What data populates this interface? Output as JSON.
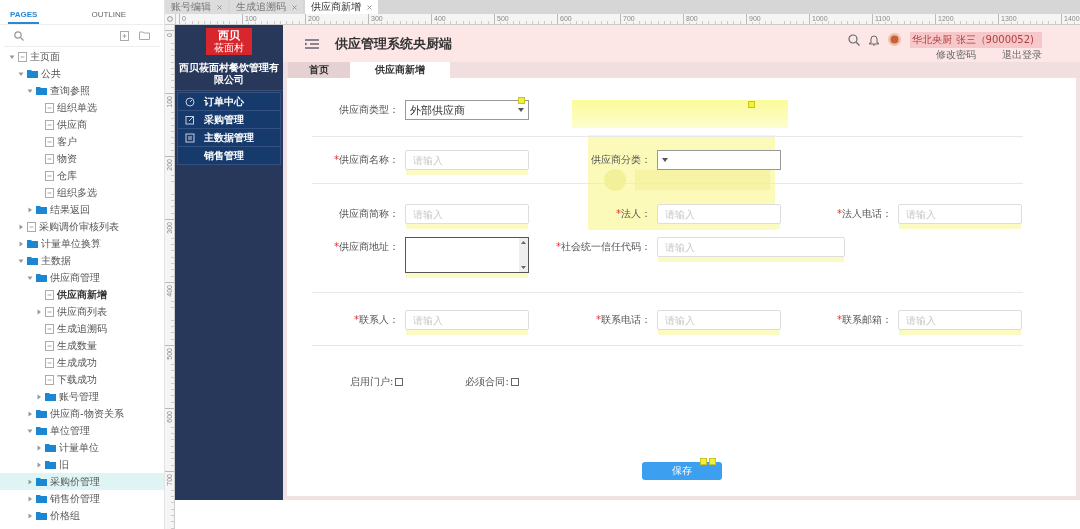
{
  "pages_panel": {
    "tabs": [
      {
        "label": "PAGES",
        "selected": true
      },
      {
        "label": "OUTLINE",
        "selected": false
      }
    ],
    "tree": [
      {
        "label": "主页面",
        "kind": "page",
        "expanded": true,
        "selected": false,
        "current": false,
        "children": [
          {
            "label": "公共",
            "kind": "folder",
            "expanded": true,
            "selected": false,
            "current": false,
            "children": [
              {
                "label": "查询参照",
                "kind": "folder",
                "expanded": true,
                "selected": false,
                "current": false,
                "children": [
                  {
                    "label": "组织单选",
                    "kind": "page",
                    "selected": false,
                    "current": false
                  },
                  {
                    "label": "供应商",
                    "kind": "page",
                    "selected": false,
                    "current": false
                  },
                  {
                    "label": "客户",
                    "kind": "page",
                    "selected": false,
                    "current": false
                  },
                  {
                    "label": "物资",
                    "kind": "page",
                    "selected": false,
                    "current": false
                  },
                  {
                    "label": "仓库",
                    "kind": "page",
                    "selected": false,
                    "current": false
                  },
                  {
                    "label": "组织多选",
                    "kind": "page",
                    "selected": false,
                    "current": false
                  }
                ]
              },
              {
                "label": "结果返回",
                "kind": "folder",
                "expanded": false,
                "selected": false,
                "current": false
              }
            ]
          },
          {
            "label": "采购调价审核列表",
            "kind": "page",
            "expanded": false,
            "selected": false,
            "current": false
          },
          {
            "label": "计量单位换算",
            "kind": "folder",
            "expanded": false,
            "selected": false,
            "current": false
          },
          {
            "label": "主数据",
            "kind": "folder",
            "expanded": true,
            "selected": false,
            "current": false,
            "children": [
              {
                "label": "供应商管理",
                "kind": "folder",
                "expanded": true,
                "selected": false,
                "current": false,
                "children": [
                  {
                    "label": "供应商新增",
                    "kind": "page",
                    "selected": false,
                    "current": true
                  },
                  {
                    "label": "供应商列表",
                    "kind": "page",
                    "expanded": false,
                    "selected": false,
                    "current": false
                  },
                  {
                    "label": "生成追溯码",
                    "kind": "page",
                    "selected": false,
                    "current": false
                  },
                  {
                    "label": "生成数量",
                    "kind": "page",
                    "selected": false,
                    "current": false
                  },
                  {
                    "label": "生成成功",
                    "kind": "page",
                    "selected": false,
                    "current": false
                  },
                  {
                    "label": "下载成功",
                    "kind": "page",
                    "selected": false,
                    "current": false
                  },
                  {
                    "label": "账号管理",
                    "kind": "folder",
                    "expanded": false,
                    "selected": false,
                    "current": false
                  }
                ]
              },
              {
                "label": "供应商-物资关系",
                "kind": "folder",
                "expanded": false,
                "selected": false,
                "current": false
              },
              {
                "label": "单位管理",
                "kind": "folder",
                "expanded": true,
                "selected": false,
                "current": false,
                "children": [
                  {
                    "label": "计量单位",
                    "kind": "folder",
                    "expanded": false,
                    "selected": false,
                    "current": false
                  },
                  {
                    "label": "旧",
                    "kind": "folder",
                    "expanded": false,
                    "selected": false,
                    "current": false
                  }
                ]
              },
              {
                "label": "采购价管理",
                "kind": "folder",
                "expanded": false,
                "selected": true,
                "current": false
              },
              {
                "label": "销售价管理",
                "kind": "folder",
                "expanded": false,
                "selected": false,
                "current": false
              },
              {
                "label": "价格组",
                "kind": "folder",
                "expanded": false,
                "selected": false,
                "current": false
              }
            ]
          }
        ]
      }
    ]
  },
  "document_tabs": [
    {
      "label": "账号编辑",
      "selected": false
    },
    {
      "label": "生成追溯码",
      "selected": false
    },
    {
      "label": "供应商新增",
      "selected": true
    }
  ],
  "ruler": {
    "horizontal": [
      "0",
      "100",
      "200",
      "300",
      "400",
      "500",
      "600",
      "700",
      "800",
      "900",
      "1000",
      "1100",
      "1200",
      "1300",
      "1400"
    ],
    "vertical": [
      "0",
      "100",
      "200",
      "300",
      "400",
      "500",
      "600",
      "700"
    ]
  },
  "app": {
    "sidebar": {
      "logo": [
        "西贝",
        "莜面村"
      ],
      "company": "西贝莜面村餐饮管理有限公司",
      "menu": [
        {
          "label": "订单中心"
        },
        {
          "label": "采购管理"
        },
        {
          "label": "主数据管理"
        },
        {
          "label": "销售管理"
        }
      ]
    },
    "header": {
      "title": "供应管理系统央厨端",
      "user": "华北央厨 张三（9000052)",
      "links": [
        "修改密码",
        "退出登录"
      ]
    },
    "tabs": [
      {
        "label": "首页",
        "selected": false
      },
      {
        "label": "供应商新增",
        "selected": true
      }
    ],
    "form": {
      "sections": [
        {
          "rows": [
            {
              "kind": "fields",
              "fields": [
                {
                  "label": "供应商类型：",
                  "kind": "select",
                  "value": "外部供应商"
                }
              ]
            }
          ]
        },
        {
          "rows": [
            {
              "kind": "fields",
              "fields": [
                {
                  "mark": "*",
                  "label": "供应商名称：",
                  "kind": "input",
                  "placeholder": "请输入"
                },
                {
                  "label": "供应商分类：",
                  "kind": "select"
                }
              ]
            }
          ]
        },
        {
          "rows": [
            {
              "kind": "fields",
              "fields": [
                {
                  "label": "供应商简称：",
                  "kind": "input",
                  "placeholder": "请输入"
                },
                {
                  "mark": "*",
                  "label": "法人：",
                  "kind": "input",
                  "placeholder": "请输入"
                },
                {
                  "mark": "*",
                  "label": "法人电话：",
                  "kind": "input",
                  "placeholder": "请输入"
                }
              ]
            },
            {
              "kind": "fields",
              "fields": [
                {
                  "mark": "*",
                  "label": "供应商地址：",
                  "kind": "textarea"
                },
                {
                  "mark": "*",
                  "label": "社会统一信任代码：",
                  "kind": "long-input",
                  "placeholder": "请输入"
                }
              ]
            }
          ]
        },
        {
          "rows": [
            {
              "kind": "fields",
              "fields": [
                {
                  "mark": "*",
                  "label": "联系人：",
                  "kind": "input",
                  "placeholder": "请输入"
                },
                {
                  "mark": "*",
                  "label": "联系电话：",
                  "kind": "input",
                  "placeholder": "请输入"
                },
                {
                  "mark": "*",
                  "label": "联系邮箱：",
                  "kind": "input",
                  "placeholder": "请输入"
                }
              ]
            }
          ]
        },
        {
          "rows": [
            {
              "kind": "checks",
              "fields": [
                {
                  "label": "启用门户:",
                  "checked": false
                },
                {
                  "label": "必须合同:",
                  "checked": false
                }
              ]
            }
          ]
        }
      ]
    },
    "save_button": "保存"
  }
}
